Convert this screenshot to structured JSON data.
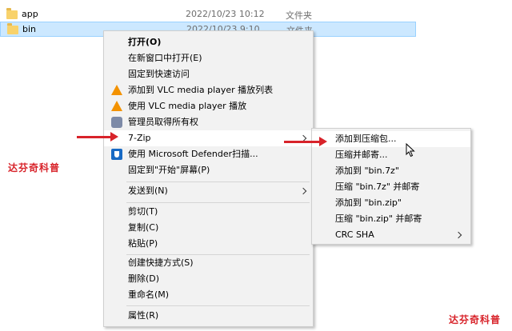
{
  "files": [
    {
      "name": "app",
      "date": "2022/10/23 10:12",
      "type": "文件夹",
      "selected": false
    },
    {
      "name": "bin",
      "date": "2022/10/23 9:10",
      "type": "文件夹",
      "selected": true
    }
  ],
  "context_menu": {
    "items": [
      {
        "label": "打开(O)"
      },
      {
        "label": "在新窗口中打开(E)"
      },
      {
        "label": "固定到快速访问"
      },
      {
        "label": "添加到 VLC media player 播放列表"
      },
      {
        "label": "使用 VLC media player 播放"
      },
      {
        "label": "管理员取得所有权"
      },
      {
        "label": "7-Zip"
      },
      {
        "label": "使用 Microsoft Defender扫描..."
      },
      {
        "label": "固定到\"开始\"屏幕(P)"
      },
      {
        "label": "发送到(N)"
      },
      {
        "label": "剪切(T)"
      },
      {
        "label": "复制(C)"
      },
      {
        "label": "粘贴(P)"
      },
      {
        "label": "创建快捷方式(S)"
      },
      {
        "label": "删除(D)"
      },
      {
        "label": "重命名(M)"
      },
      {
        "label": "属性(R)"
      }
    ]
  },
  "submenu": {
    "items": [
      {
        "label": "添加到压缩包..."
      },
      {
        "label": "压缩并邮寄..."
      },
      {
        "label": "添加到 \"bin.7z\""
      },
      {
        "label": "压缩 \"bin.7z\" 并邮寄"
      },
      {
        "label": "添加到 \"bin.zip\""
      },
      {
        "label": "压缩 \"bin.zip\" 并邮寄"
      },
      {
        "label": "CRC SHA"
      }
    ]
  },
  "watermarks": {
    "left": "达芬奇科普",
    "bottom_right": "达芬奇科普"
  },
  "colors": {
    "selection": "#cce8ff",
    "menu_bg": "#f2f2f2",
    "annotation_arrow": "#d8232a"
  }
}
